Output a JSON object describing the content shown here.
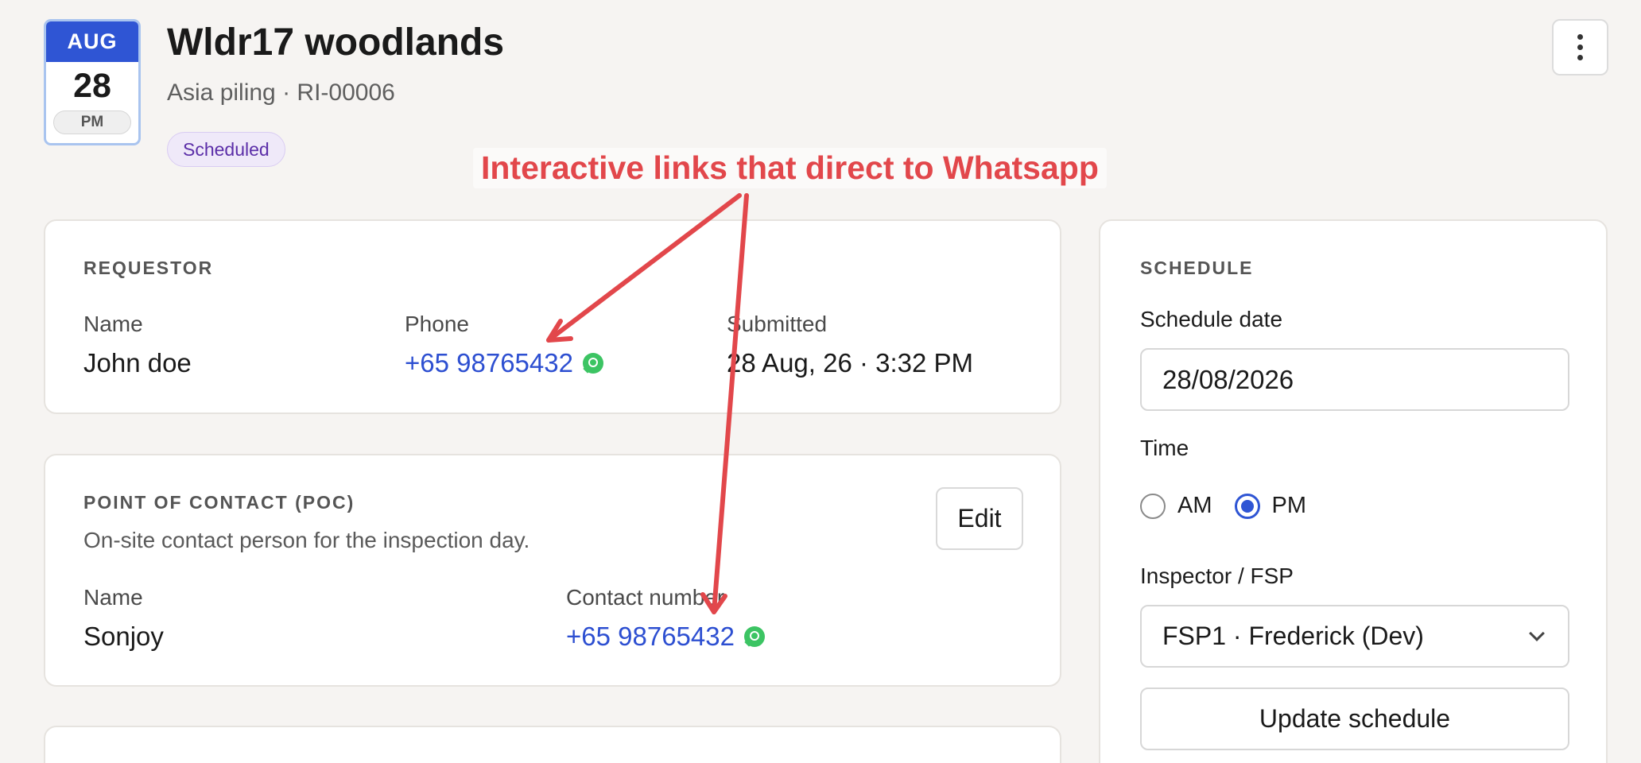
{
  "header": {
    "date_month": "AUG",
    "date_day": "28",
    "date_period": "PM",
    "title": "Wldr17 woodlands",
    "subtitle": "Asia piling · RI-00006",
    "status": "Scheduled"
  },
  "requestor": {
    "section_label": "REQUESTOR",
    "name_label": "Name",
    "name_value": "John doe",
    "phone_label": "Phone",
    "phone_value": "+65 98765432",
    "submitted_label": "Submitted",
    "submitted_value": "28 Aug, 26 · 3:32 PM"
  },
  "poc": {
    "section_label": "POINT OF CONTACT (POC)",
    "description": "On-site contact person for the inspection day.",
    "edit_label": "Edit",
    "name_label": "Name",
    "name_value": "Sonjoy",
    "contact_label": "Contact number",
    "contact_value": "+65 98765432"
  },
  "schedule": {
    "section_label": "SCHEDULE",
    "date_label": "Schedule date",
    "date_value": "28/08/2026",
    "time_label": "Time",
    "time_options": [
      "AM",
      "PM"
    ],
    "time_selected": "PM",
    "inspector_label": "Inspector / FSP",
    "inspector_value": "FSP1 · Frederick (Dev)",
    "update_label": "Update schedule"
  },
  "annotation": {
    "text": "Interactive links that direct to Whatsapp",
    "color": "#e2474b"
  },
  "colors": {
    "accent": "#2f55d4",
    "link": "#2d4fd1",
    "whatsapp": "#3cc463",
    "status_text": "#5b2ea8"
  },
  "icons": [
    "whatsapp-icon",
    "more-vertical-icon",
    "chevron-down-icon"
  ]
}
